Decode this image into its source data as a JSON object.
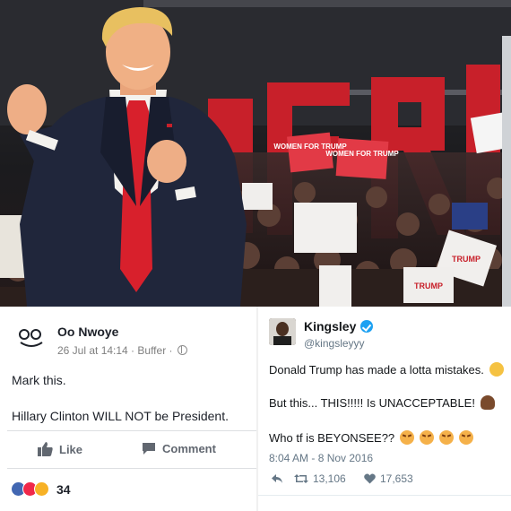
{
  "photo": {
    "backdrop_letters": "AFRI",
    "signs": [
      "WOMEN FOR TRUMP",
      "WOMEN FOR TRUMP",
      "TRUMP",
      "TRUMP"
    ]
  },
  "facebook_post": {
    "author": "Oo Nwoye",
    "meta": "26 Jul at 14:14 · Buffer ·",
    "line1": "Mark this.",
    "line2": "Hillary Clinton WILL NOT be President.",
    "like_label": "Like",
    "comment_label": "Comment",
    "reaction_count": "34",
    "colors": {
      "like": "#4267b2",
      "love": "#f0284a",
      "haha": "#f7b125",
      "text": "#1d2129",
      "muted": "#616770"
    }
  },
  "tweet": {
    "name": "Kingsley",
    "handle": "@kingsleyyy",
    "line1": "Donald Trump has made a lotta mistakes.",
    "line2": "But this... THIS!!!!! Is UNACCEPTABLE!",
    "line3": "Who tf is BEYONSEE??",
    "timestamp": "8:04 AM - 8 Nov 2016",
    "retweets": "13,106",
    "likes": "17,653",
    "icons": [
      "reply-icon",
      "retweet-icon",
      "heart-icon"
    ],
    "colors": {
      "verified": "#1da1f2",
      "muted": "#657786"
    }
  }
}
